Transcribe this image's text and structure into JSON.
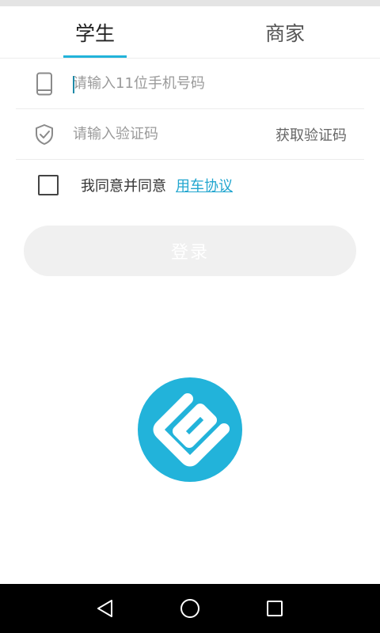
{
  "tabs": [
    {
      "label": "学生",
      "active": true
    },
    {
      "label": "商家",
      "active": false
    }
  ],
  "form": {
    "phone_placeholder": "请输入11位手机号码",
    "code_placeholder": "请输入验证码",
    "get_code_label": "获取验证码"
  },
  "agreement": {
    "text": "我同意并同意",
    "link": "用车协议",
    "checked": false
  },
  "login": {
    "label": "登录",
    "enabled": false
  },
  "colors": {
    "accent": "#22b3da",
    "disabled_button": "#f0f0f0"
  },
  "icons": {
    "phone_field": "phone-icon",
    "code_field": "shield-check-icon",
    "logo": "e-logo-icon",
    "nav_back": "back-triangle-icon",
    "nav_home": "home-circle-icon",
    "nav_recent": "recent-square-icon"
  }
}
